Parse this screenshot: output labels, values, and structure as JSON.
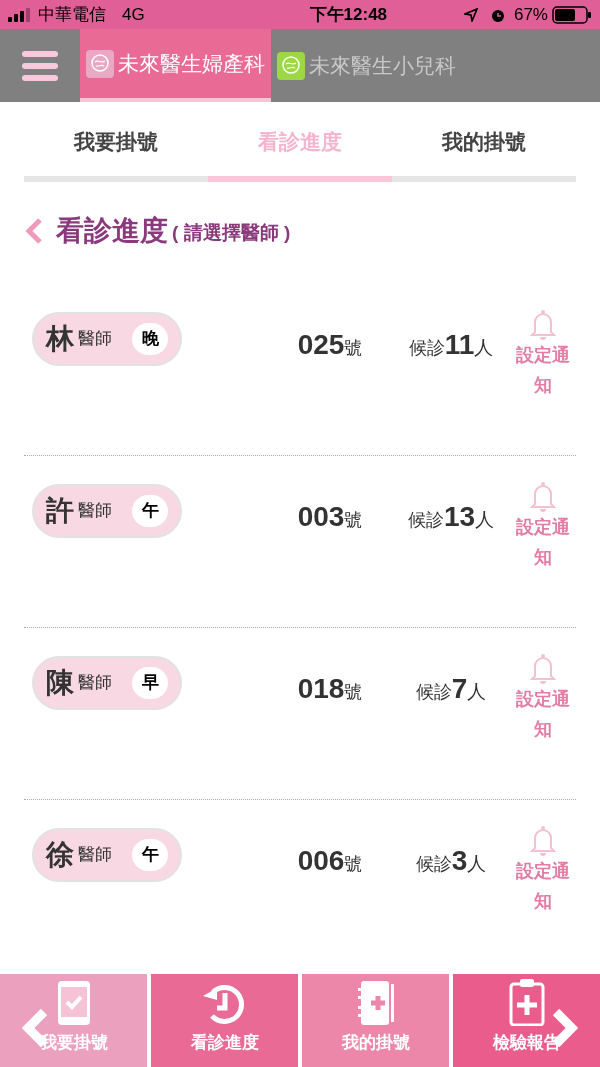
{
  "status_bar": {
    "carrier": "中華電信",
    "network": "4G",
    "time": "下午12:48",
    "battery": "67%"
  },
  "clinics": [
    {
      "label": "未來醫生婦產科",
      "selected": true,
      "color": "#e9a9c4"
    },
    {
      "label": "未來醫生小兒科",
      "selected": false,
      "color": "#9bd843"
    }
  ],
  "tabs": [
    {
      "label": "我要掛號",
      "selected": false
    },
    {
      "label": "看診進度",
      "selected": true
    },
    {
      "label": "我的掛號",
      "selected": false
    }
  ],
  "heading": {
    "title": "看診進度",
    "hint": "( 請選擇醫師 )"
  },
  "doctors": [
    {
      "surname": "林",
      "title": "醫師",
      "session": "晚",
      "number": "025",
      "number_unit": "號",
      "waiting_label": "候診",
      "waiting": "11",
      "waiting_unit": "人",
      "notify": "設定通知"
    },
    {
      "surname": "許",
      "title": "醫師",
      "session": "午",
      "number": "003",
      "number_unit": "號",
      "waiting_label": "候診",
      "waiting": "13",
      "waiting_unit": "人",
      "notify": "設定通知"
    },
    {
      "surname": "陳",
      "title": "醫師",
      "session": "早",
      "number": "018",
      "number_unit": "號",
      "waiting_label": "候診",
      "waiting": "7",
      "waiting_unit": "人",
      "notify": "設定通知"
    },
    {
      "surname": "徐",
      "title": "醫師",
      "session": "午",
      "number": "006",
      "number_unit": "號",
      "waiting_label": "候診",
      "waiting": "3",
      "waiting_unit": "人",
      "notify": "設定通知"
    }
  ],
  "bottom_nav": [
    {
      "label": "我要掛號",
      "kind": "phone",
      "color": "#eba0bd"
    },
    {
      "label": "看診進度",
      "kind": "history",
      "color": "#e96a95"
    },
    {
      "label": "我的掛號",
      "kind": "notebook",
      "color": "#ec87a9"
    },
    {
      "label": "檢驗報告",
      "kind": "clipboard",
      "color": "#ea5c8c"
    }
  ]
}
